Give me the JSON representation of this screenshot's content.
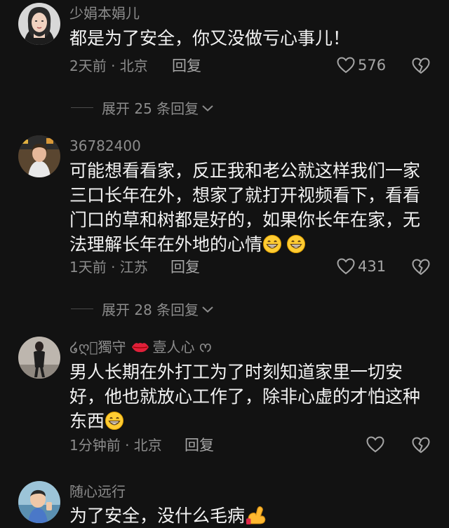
{
  "comments": [
    {
      "username": "少娟本娟儿",
      "text": "都是为了安全，你又没做亏心事儿！",
      "meta": "2天前 · 北京",
      "reply": "回复",
      "likes": "576"
    },
    {
      "username": "36782400",
      "text": "可能想看看家，反正我和老公就这样我们一家三口长年在外，想家了就打开视频看下，看看门口的草和树都是好的，如果你长年在家，无法理解长年在外地的心情",
      "meta": "1天前 · 江苏",
      "reply": "回复",
      "likes": "431"
    },
    {
      "username_part1": "໒ღ⃝獨守",
      "username_part2": "壹人心",
      "username_part3": "ᰔ",
      "text": "男人长期在外打工为了时刻知道家里一切安好，他也就放心工作了，除非心虚的才怕这种东西",
      "meta": "1分钟前 · 北京",
      "reply": "回复",
      "likes": ""
    },
    {
      "username": "随心远行",
      "text": "为了安全，没什么毛病"
    }
  ],
  "expand_replies": [
    "展开 25 条回复",
    "展开 28 条回复"
  ],
  "icons": {
    "like": "heart-outline-icon",
    "dislike": "broken-heart-icon",
    "expand": "chevron-down-icon",
    "emoji_grin": "grinning-face-icon",
    "emoji_lips": "kiss-lips-icon",
    "emoji_muscle": "flexed-biceps-icon"
  },
  "colors": {
    "background": "#121212",
    "primary_text": "#f2f2f2",
    "secondary_text": "#8c8c8c"
  }
}
